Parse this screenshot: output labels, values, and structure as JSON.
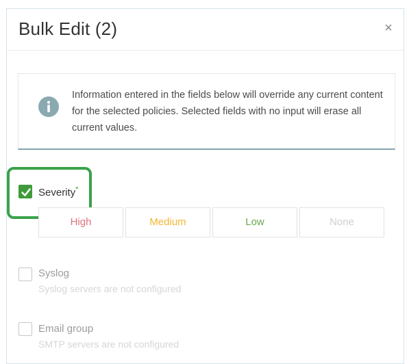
{
  "dialog": {
    "title": "Bulk Edit (2)",
    "close_label": "×"
  },
  "info": {
    "icon": "info-icon",
    "text": "Information entered in the fields below will override any current content for the selected policies. Selected fields with no input will erase all current values."
  },
  "severity": {
    "label": "Severity",
    "required_mark": "*",
    "checked": true,
    "options": [
      {
        "label": "High",
        "color": "#e0707a"
      },
      {
        "label": "Medium",
        "color": "#f2b632"
      },
      {
        "label": "Low",
        "color": "#6aa84f"
      },
      {
        "label": "None",
        "color": "#cfcfcf"
      }
    ]
  },
  "syslog": {
    "label": "Syslog",
    "checked": false,
    "note": "Syslog servers are not configured"
  },
  "email_group": {
    "label": "Email group",
    "checked": false,
    "note": "SMTP servers are not configured"
  },
  "colors": {
    "accent_green": "#3f9b3a",
    "highlight_green": "#3aa24a",
    "info_icon": "#8aa9b1"
  }
}
